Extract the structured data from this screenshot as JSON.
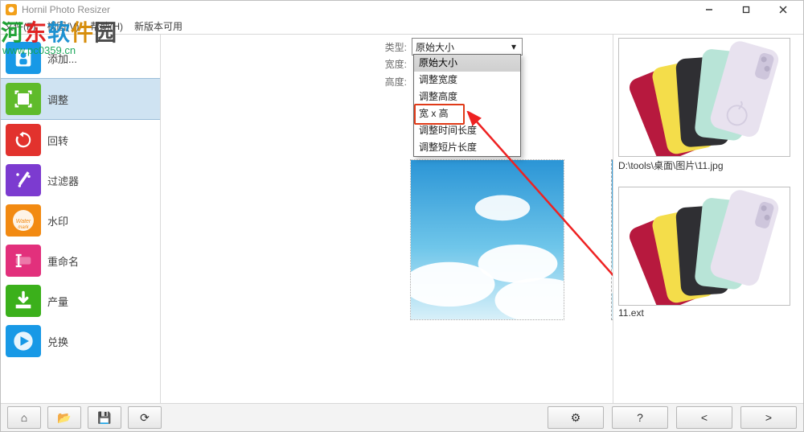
{
  "titlebar": {
    "title": "Hornil Photo Resizer"
  },
  "menu": [
    "文件(F)",
    "视图(V)",
    "帮助(H)",
    "新版本可用"
  ],
  "sidebar": [
    {
      "label": "添加...",
      "icon": "add-photo",
      "bg": "#1899e6"
    },
    {
      "label": "调整",
      "icon": "resize",
      "bg": "#5fbb2b",
      "selected": true
    },
    {
      "label": "回转",
      "icon": "rotate",
      "bg": "#e2322d"
    },
    {
      "label": "过滤器",
      "icon": "wand",
      "bg": "#7c3bd0"
    },
    {
      "label": "水印",
      "icon": "watermark",
      "bg": "#f28a12"
    },
    {
      "label": "重命名",
      "icon": "rename",
      "bg": "#e2307c"
    },
    {
      "label": "产量",
      "icon": "output",
      "bg": "#3bb01b"
    },
    {
      "label": "兑换",
      "icon": "convert",
      "bg": "#1899e6"
    }
  ],
  "form": {
    "type_label": "类型:",
    "width_label": "宽度:",
    "height_label": "高度:",
    "type_value": "原始大小",
    "options": [
      "原始大小",
      "调整宽度",
      "调整高度",
      "宽 x 高",
      "调整时间长度",
      "调整短片长度"
    ]
  },
  "right": {
    "path1": "D:\\tools\\桌面\\图片\\11.jpg",
    "path2": "11.ext"
  },
  "bottom": {
    "home": "⌂",
    "open": "📂",
    "save": "💾",
    "refresh": "⟳",
    "gear": "⚙",
    "help": "?",
    "prev": "<",
    "next": ">"
  },
  "watermark": {
    "line1": "河东软件园",
    "line2": "www.pc0359.cn"
  }
}
